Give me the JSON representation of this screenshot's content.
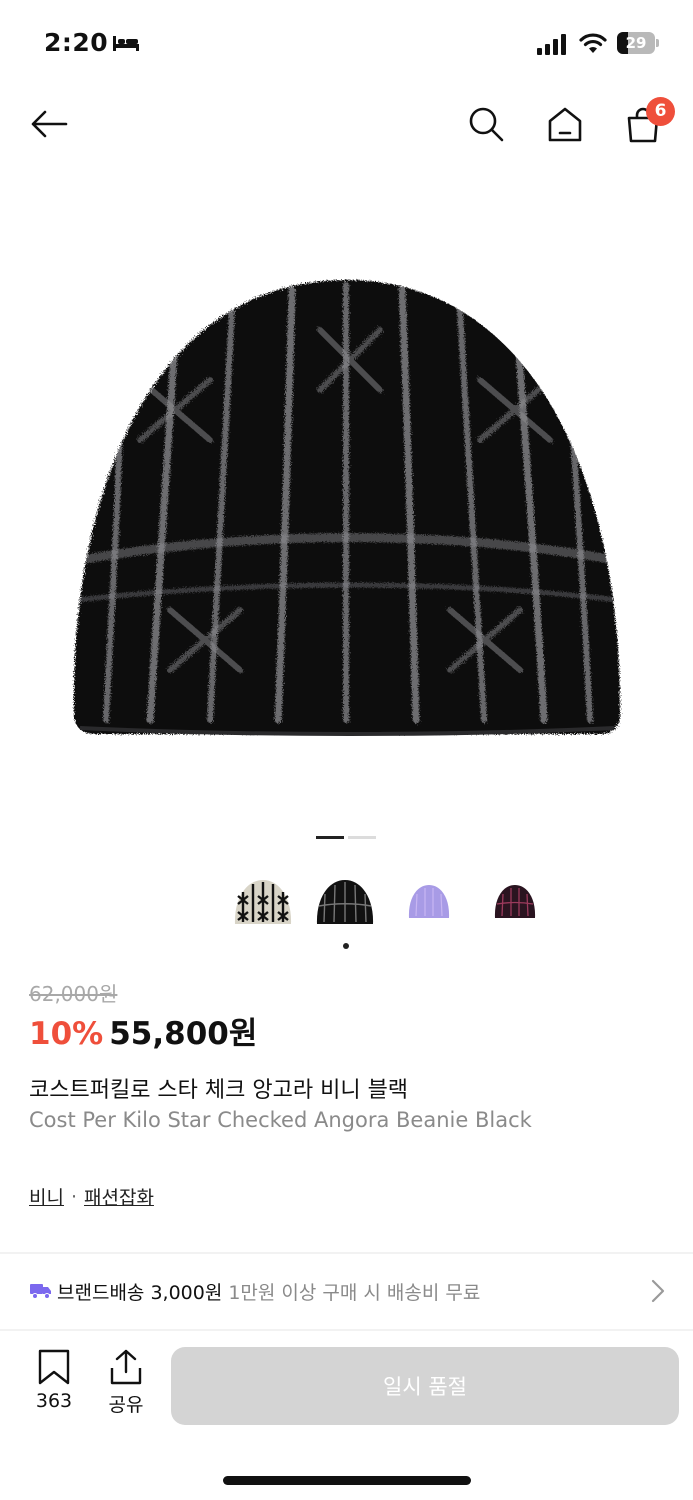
{
  "status_bar": {
    "time": "2:20",
    "battery_level": "29",
    "icons": [
      "bed-icon",
      "signal-icon",
      "wifi-icon",
      "battery-icon"
    ]
  },
  "nav": {
    "icons": [
      "back-arrow-icon",
      "search-icon",
      "home-icon",
      "shopping-bag-icon"
    ],
    "cart_count": "6"
  },
  "gallery": {
    "image_count": 2,
    "active_index": 0,
    "color_options": [
      {
        "name": "cream",
        "color": "#d8d4c7"
      },
      {
        "name": "black",
        "color": "#111111"
      },
      {
        "name": "lavender",
        "color": "#a89be6"
      },
      {
        "name": "burgundy",
        "color": "#2a1420"
      }
    ],
    "selected_color_index": 1
  },
  "product": {
    "original_price": "62,000원",
    "discount": "10%",
    "sale_price": "55,800원",
    "title_ko": "코스트퍼킬로 스타 체크 앙고라 비니 블랙",
    "title_en": "Cost Per Kilo Star Checked Angora Beanie Black",
    "category": "비니",
    "category_parent": "패션잡화",
    "category_separator": "·"
  },
  "shipping": {
    "label": "브랜드배송 3,000원",
    "note": "1만원 이상 구매 시 배송비 무료"
  },
  "bottom_bar": {
    "bookmark_count": "363",
    "share_label": "공유",
    "soldout_label": "일시 품절"
  },
  "colors": {
    "accent": "#ef4f3b",
    "truck": "#7b68ee",
    "disabled_button": "#d4d4d4"
  }
}
